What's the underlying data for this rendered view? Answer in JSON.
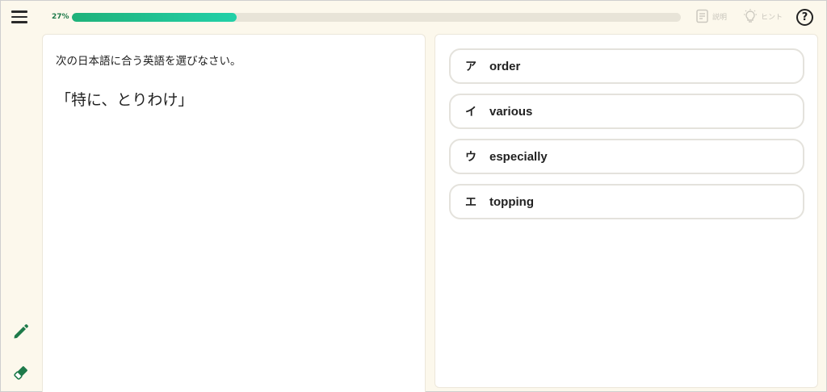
{
  "header": {
    "menu_icon": "hamburger-menu-icon",
    "progress": {
      "label": "27%",
      "value": 0.27,
      "color_start": "#1fb27a",
      "color_end": "#22d0a8"
    },
    "explanation_label": "説明",
    "hint_label": "ヒント",
    "help_symbol": "?"
  },
  "question_panel": {
    "instruction": "次の日本語に合う英語を選びなさい。",
    "question": "「特に、とりわけ」"
  },
  "choices": [
    {
      "key": "ア",
      "text": "order"
    },
    {
      "key": "イ",
      "text": "various"
    },
    {
      "key": "ウ",
      "text": "especially"
    },
    {
      "key": "エ",
      "text": "topping"
    }
  ],
  "sidebar_tools": {
    "pencil_icon": "pencil-icon",
    "eraser_icon": "eraser-icon",
    "tool_color": "#1e7a4a"
  }
}
